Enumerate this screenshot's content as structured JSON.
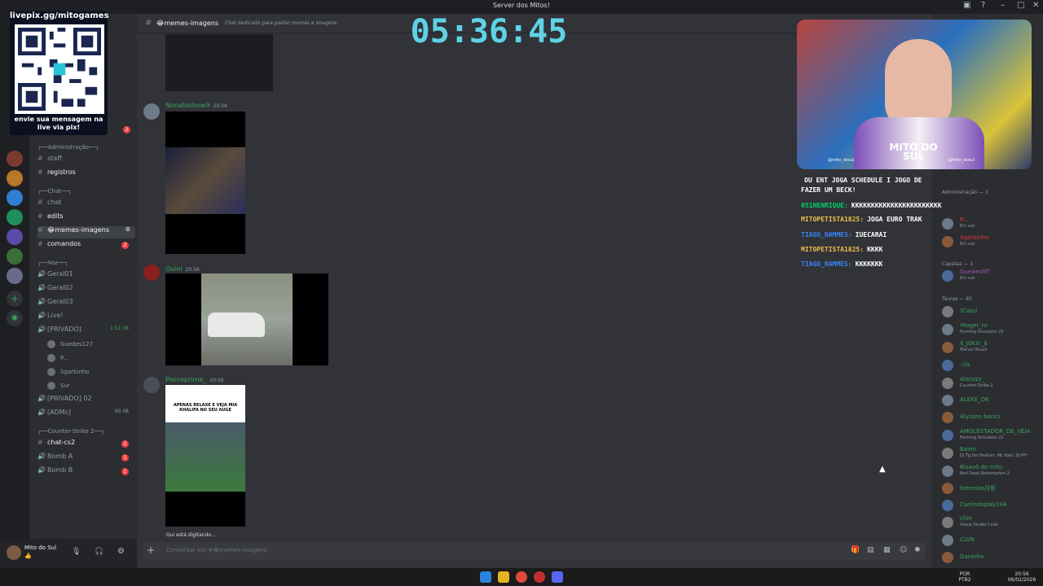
{
  "window": {
    "title": "Server dos Mitos!"
  },
  "channel_header": {
    "name": "😂memes-imagens",
    "topic": "Chat dedicado para postar memes e imagens."
  },
  "sidebar": {
    "categories": [
      "Administração",
      "Chat",
      "Voz",
      "Counter-Strike 2"
    ],
    "channels": [
      {
        "label": "staff"
      },
      {
        "label": "registros"
      },
      {
        "label": "chat"
      },
      {
        "label": "edits"
      },
      {
        "label": "😂memes-imagens"
      },
      {
        "label": "comandos",
        "badge": "2"
      },
      {
        "label": "Geral01"
      },
      {
        "label": "Geral02"
      },
      {
        "label": "Geral03"
      },
      {
        "label": "Live!"
      },
      {
        "label": "[PRIVADO]",
        "time": "1:51:38"
      },
      {
        "label": "[PRIVADO] 02"
      },
      {
        "label": "[ADMs]",
        "counts": "00  08"
      },
      {
        "label": "chat-cs2",
        "badge": "2"
      },
      {
        "label": "Bomb A",
        "badge": "1"
      },
      {
        "label": "Bomb B",
        "badge": "1"
      }
    ],
    "voice_users": [
      "Guedes127",
      "P...",
      "Sgarbinho",
      "Sur"
    ],
    "badge_top": "2"
  },
  "user_panel": {
    "name": "Mito do Sul",
    "status": "👍"
  },
  "messages": [
    {
      "author": "Nonatoshow9",
      "time": "20:56"
    },
    {
      "author": "Ovini",
      "time": "20:56"
    },
    {
      "author": "Pierreprime_",
      "time": "20:56",
      "video_caption": "APENAS RELAXE E VEJA MIA KHALIFA NO SEU AUGE"
    }
  ],
  "typing": {
    "text": "Gui está digitando..."
  },
  "composer": {
    "placeholder": "Conversar em #😂memes-imagens"
  },
  "overlay": {
    "qr_url": "livepix.gg/mitogames",
    "qr_text": "envie sua mensagem na live via pix!",
    "timer": "05:36:45",
    "cam_name": "MITO DO SUL",
    "cam_handle_left": "@mito_dosul",
    "cam_handle_right": "@mito_dosul"
  },
  "stream_chat": [
    {
      "user": "",
      "text": "OU ENT JOGA SCHEDULE I JOGO DE FAZER UM BECK!",
      "color": "#ffffff"
    },
    {
      "user": "051HENRIQUE:",
      "text": "KKKKKKKKKKKKKKKKKKKKKKK",
      "color": "#00d26a"
    },
    {
      "user": "MITOPETISTA1825:",
      "text": "JOGA EURO TRAK",
      "color": "#f0c24b"
    },
    {
      "user": "TIAGO_NAMMES:",
      "text": "IUECARAI",
      "color": "#3b82f6"
    },
    {
      "user": "MITOPETISTA1825:",
      "text": "KKKK",
      "color": "#f0c24b"
    },
    {
      "user": "TIAGO_NAMMES:",
      "text": "KKKKKKK",
      "color": "#3b82f6"
    }
  ],
  "members": {
    "groups": [
      "Administração — 3",
      "Capataz — 1",
      "Tauras — 83"
    ],
    "list": [
      {
        "name": "P...",
        "status": "Em voz",
        "color": "#e23a3a"
      },
      {
        "name": "Sgarbinho",
        "status": "Em voz",
        "color": "#e23a3a"
      },
      {
        "name": "GuedesMT",
        "status": "Em voz",
        "color": "#9b59b6"
      },
      {
        "name": "!Cassi",
        "status": "",
        "color": "#3ba55d"
      },
      {
        "name": "!Roger_nr",
        "status": "Farming Simulator 25",
        "color": "#3ba55d"
      },
      {
        "name": "$_J0k3r_$",
        "status": "Marvel Rivals",
        "color": "#3ba55d"
      },
      {
        "name": ".cla",
        "status": "",
        "color": "#3ba55d"
      },
      {
        "name": "Alanzzz_",
        "status": "Counter-Strike 2",
        "color": "#3ba55d"
      },
      {
        "name": "ALEKE_DK",
        "status": "",
        "color": "#3ba55d"
      },
      {
        "name": "Alysson bencz",
        "status": "",
        "color": "#3ba55d"
      },
      {
        "name": "AMOLESTADOR_DE_VEIA",
        "status": "Farming Simulator 22",
        "color": "#3ba55d"
      },
      {
        "name": "Balen",
        "status": "Dj Tg De Heatlan, Mc Kalo, DJ PH",
        "color": "#3ba55d"
      },
      {
        "name": "Bisavô do mito",
        "status": "Red Dead Redemption 2",
        "color": "#3ba55d"
      },
      {
        "name": "brenelas月影",
        "status": "",
        "color": "#3ba55d"
      },
      {
        "name": "Carlindoplay244",
        "status": "",
        "color": "#3ba55d"
      },
      {
        "name": "chin",
        "status": "Visual Studio Code",
        "color": "#3ba55d"
      },
      {
        "name": "CLVN",
        "status": "",
        "color": "#3ba55d"
      },
      {
        "name": "Daninho",
        "status": "",
        "color": "#3ba55d"
      }
    ]
  },
  "taskbar": {
    "lang": "POR PTB2",
    "time": "20:56",
    "date": "06/02/2026"
  }
}
